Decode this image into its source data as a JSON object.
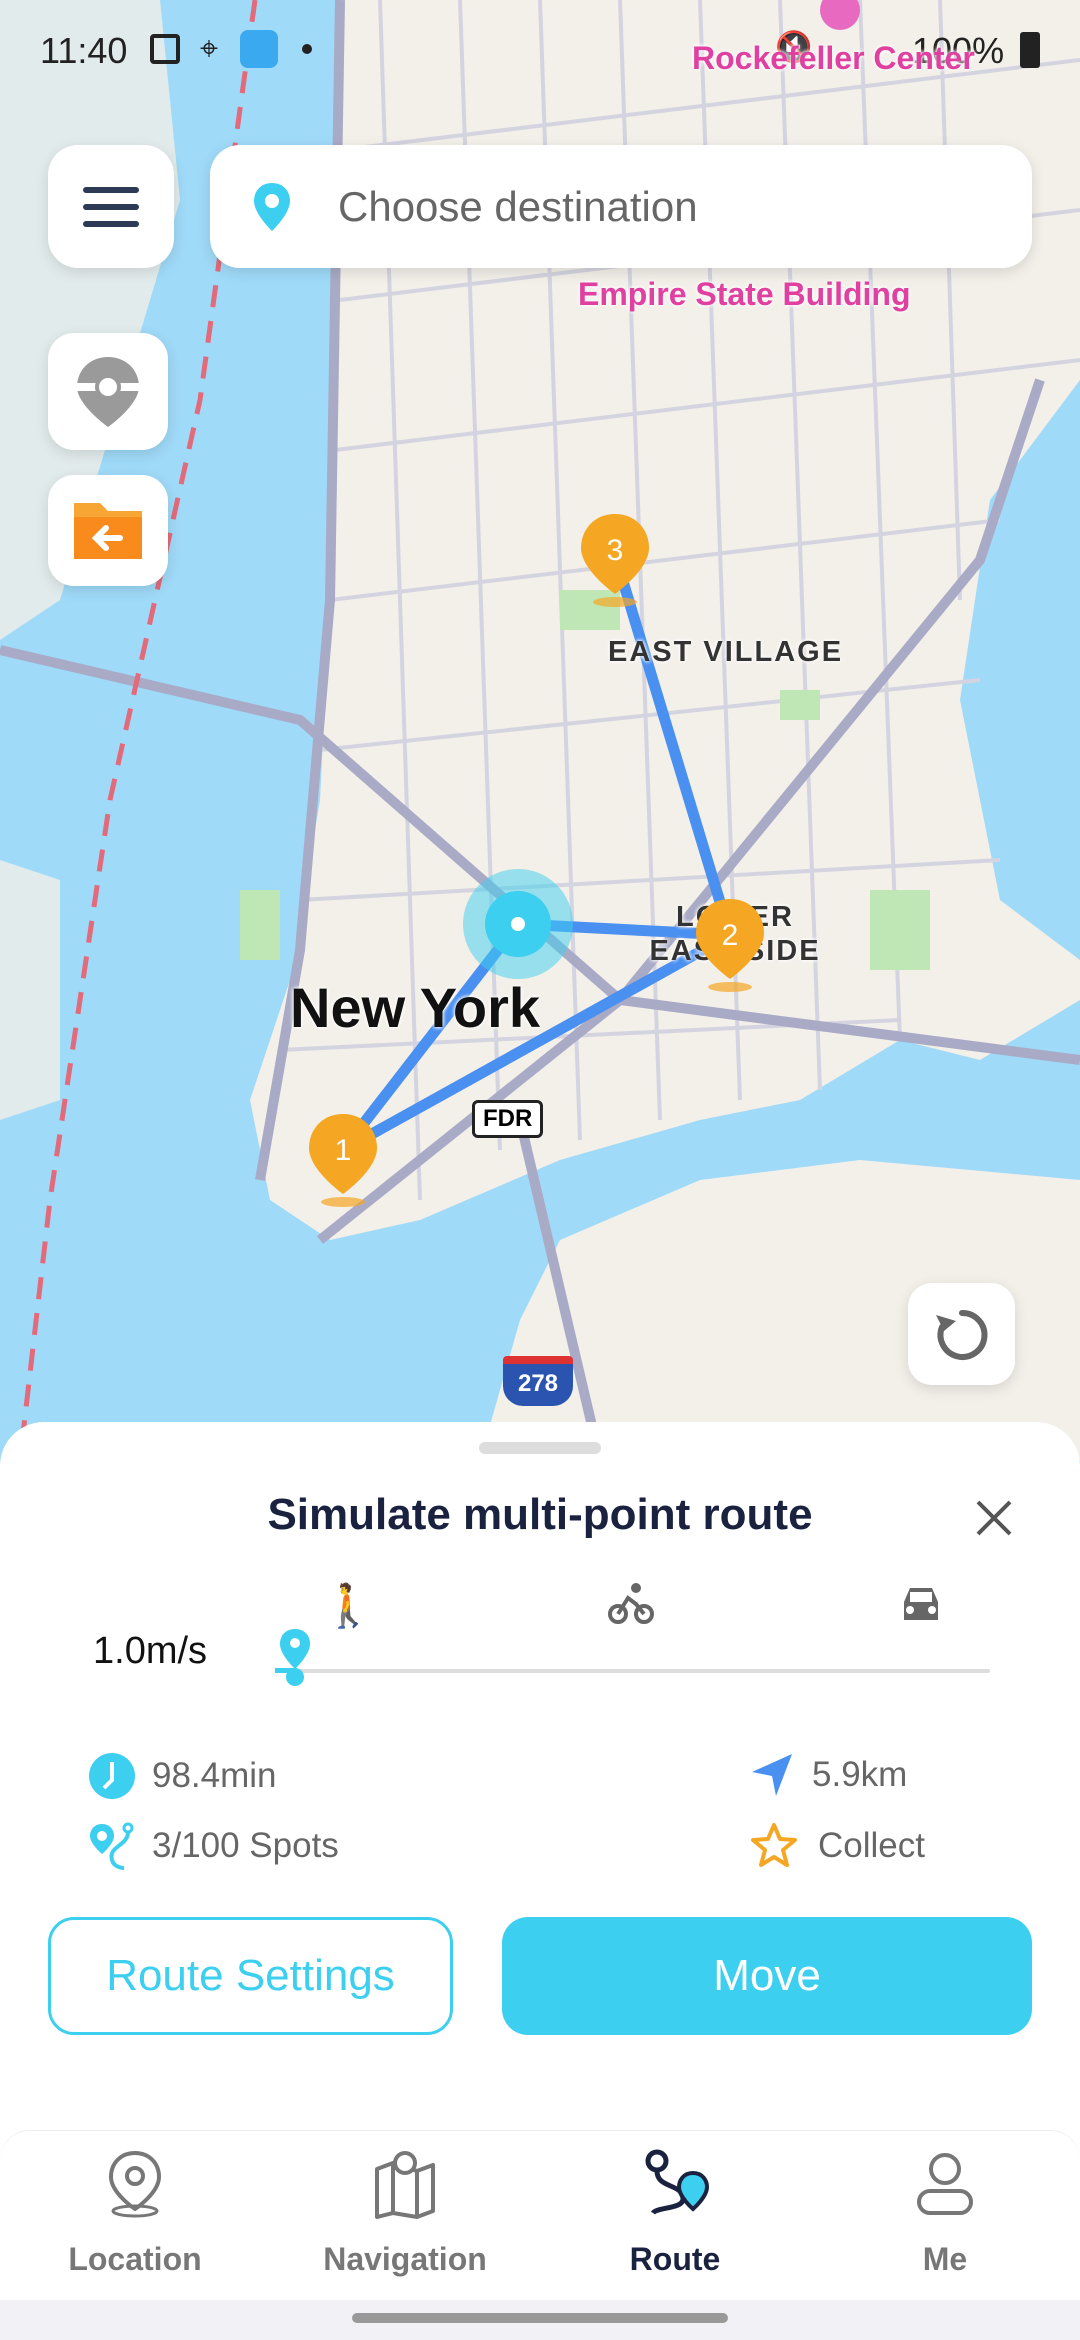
{
  "status_bar": {
    "time": "11:40",
    "battery": "100%"
  },
  "map": {
    "poi_labels": [
      "Rockefeller Center",
      "Empire State Building"
    ],
    "area_labels": [
      "EAST VILLAGE",
      "LOWER EAST SIDE"
    ],
    "city_label": "New York",
    "road_badges": [
      "FDR",
      "278"
    ],
    "route_points": [
      "1",
      "2",
      "3"
    ]
  },
  "search": {
    "placeholder": "Choose destination"
  },
  "sheet": {
    "title": "Simulate multi-point route",
    "speed": "1.0m/s",
    "speed_fraction": 0.0,
    "modes": [
      "walk-icon",
      "bike-icon",
      "car-icon"
    ],
    "time": "98.4min",
    "distance": "5.9km",
    "spots": "3/100 Spots",
    "collect": "Collect",
    "route_settings_label": "Route Settings",
    "move_label": "Move"
  },
  "nav": {
    "items": [
      {
        "label": "Location"
      },
      {
        "label": "Navigation"
      },
      {
        "label": "Route",
        "active": true
      },
      {
        "label": "Me"
      }
    ]
  },
  "colors": {
    "accent": "#3ccfef",
    "marker": "#f5a623",
    "route": "#4a90f0",
    "poi": "#e040a0"
  }
}
